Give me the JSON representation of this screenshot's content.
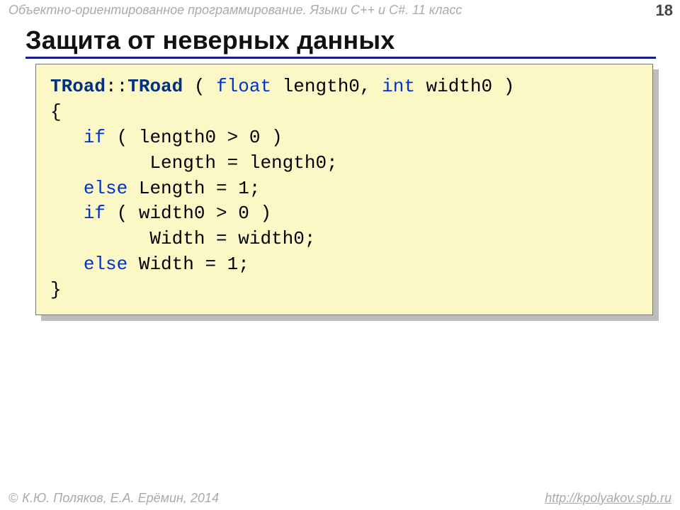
{
  "header": {
    "course": "Объектно-ориентированное программирование. Языки C++ и C#. 11 класс",
    "page": "18"
  },
  "title": "Защита от неверных данных",
  "code": {
    "l1_a": "TRoad",
    "l1_b": "::",
    "l1_c": "TRoad",
    "l1_d": " ( ",
    "l1_e": "float",
    "l1_f": " length0, ",
    "l1_g": "int",
    "l1_h": " width0 )",
    "l2": "{",
    "l3_a": "   ",
    "l3_b": "if",
    "l3_c": " ( length0 > 0 )",
    "l4": "         Length = length0;",
    "l5_a": "   ",
    "l5_b": "else",
    "l5_c": " Length = 1;",
    "l6_a": "   ",
    "l6_b": "if",
    "l6_c": " ( width0 > 0 )",
    "l7": "         Width = width0;",
    "l8_a": "   ",
    "l8_b": "else",
    "l8_c": " Width = 1;",
    "l9": "}"
  },
  "footer": {
    "copyright": "К.Ю. Поляков, Е.А. Ерёмин, 2014",
    "url": "http://kpolyakov.spb.ru"
  }
}
